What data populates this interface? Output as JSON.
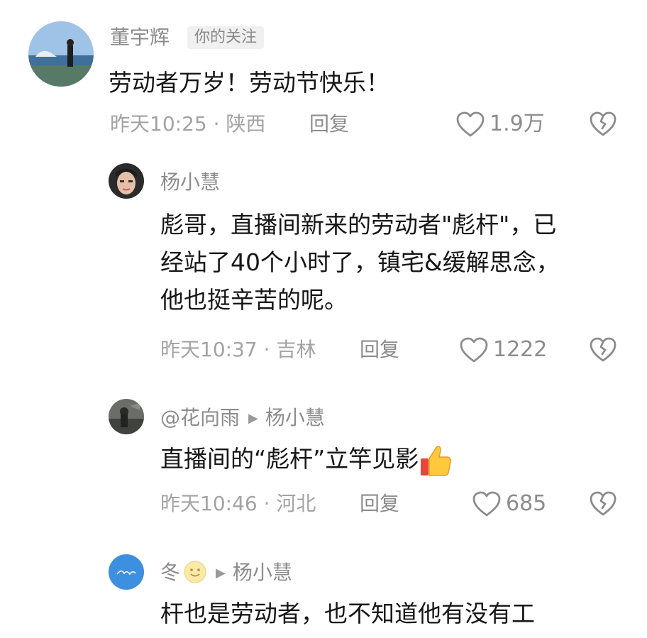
{
  "comments": [
    {
      "author": "董宇辉",
      "badge": "你的关注",
      "content": "劳动者万岁！劳动节快乐！",
      "time_location": "昨天10:25 · 陕西",
      "reply_label": "回复",
      "likes": "1.9万"
    },
    {
      "author": "杨小慧",
      "content_lines": [
        "彪哥，直播间新来的劳动者\"彪杆\"，已",
        "经站了40个小时了，镇宅&缓解思念，",
        "他也挺辛苦的呢。"
      ],
      "time_location": "昨天10:37 · 吉林",
      "reply_label": "回复",
      "likes": "1222"
    },
    {
      "author": "@花向雨",
      "reply_to": "杨小慧",
      "content": "直播间的“彪杆”立竿见影",
      "content_emoji": "thumbs-up-emoji",
      "time_location": "昨天10:46 · 河北",
      "reply_label": "回复",
      "likes": "685"
    },
    {
      "author": "冬",
      "author_emoji": "smiley-face-emoji",
      "reply_to": "杨小慧",
      "content": "杆也是劳动者，也不知道他有没有工"
    }
  ],
  "icons": {
    "like": "heart-outline-icon",
    "dislike": "broken-heart-icon",
    "reply_arrow": "play-triangle-icon"
  },
  "colors": {
    "text": "#161616",
    "muted": "#8c8c8c",
    "meta": "#a3a3a3",
    "badge_bg": "#f0f0f0"
  }
}
